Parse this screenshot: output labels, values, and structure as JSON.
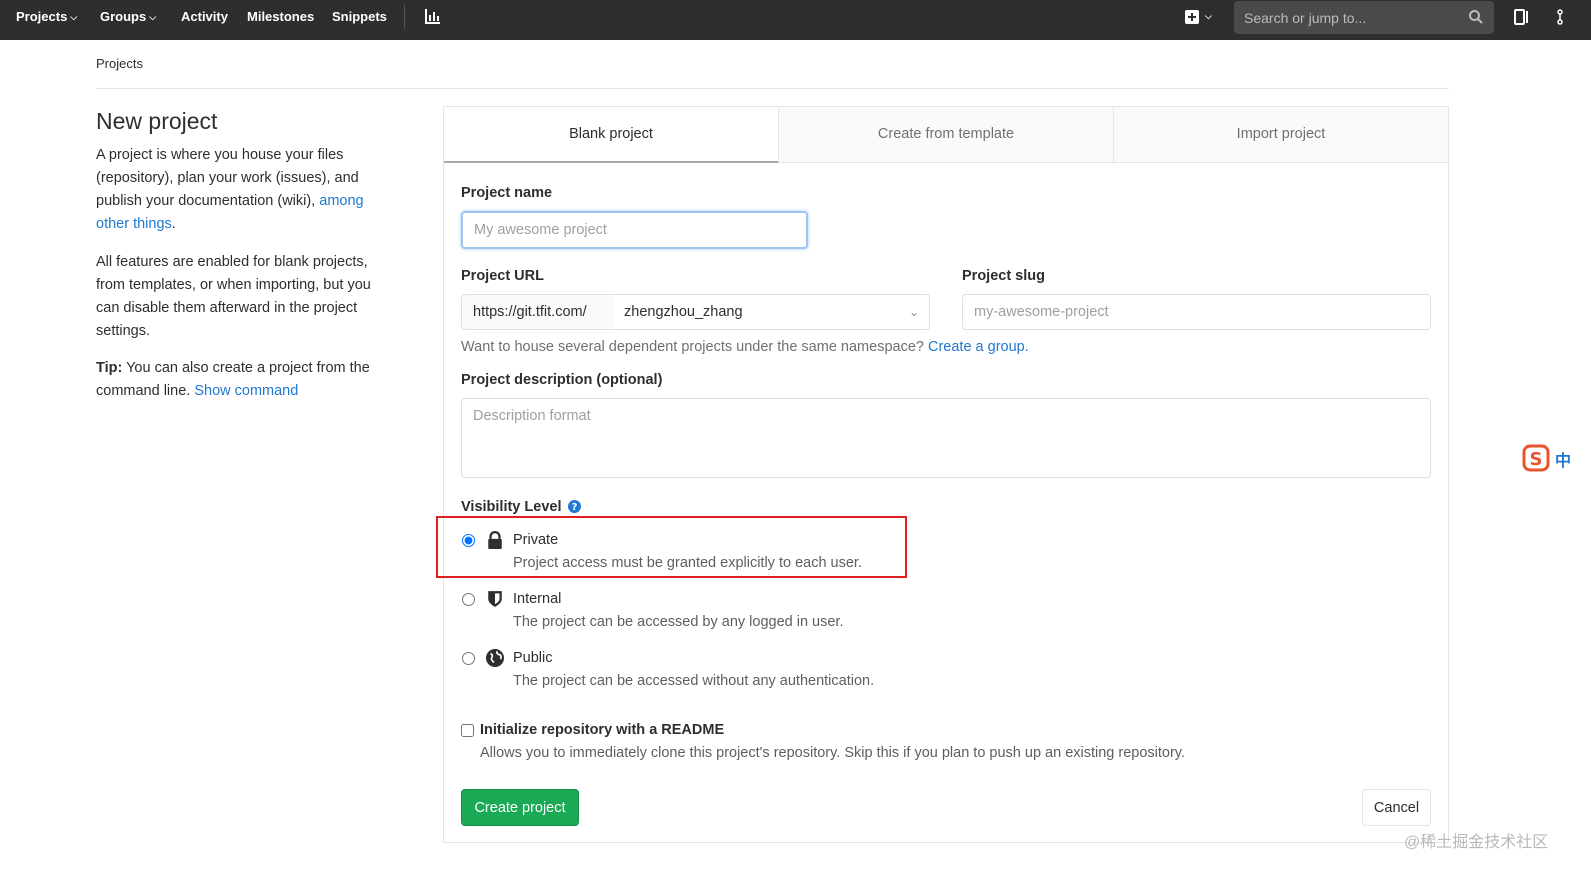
{
  "navbar": {
    "items": [
      {
        "label": "Projects",
        "has_dropdown": true
      },
      {
        "label": "Groups",
        "has_dropdown": true
      },
      {
        "label": "Activity",
        "has_dropdown": false
      },
      {
        "label": "Milestones",
        "has_dropdown": false
      },
      {
        "label": "Snippets",
        "has_dropdown": false
      }
    ],
    "chart_icon": "chart-icon",
    "new_icon": "plus-square-icon",
    "search": {
      "placeholder": "Search or jump to...",
      "icon": "search-icon"
    },
    "right_icons": [
      "issues-icon",
      "merge-request-icon"
    ]
  },
  "breadcrumb": {
    "label": "Projects"
  },
  "intro": {
    "title": "New project",
    "para1_text": "A project is where you house your files (repository), plan your work (issues), and publish your documentation (wiki),",
    "para1_link": "among other things",
    "para1_end": ".",
    "para2": "All features are enabled for blank projects, from templates, or when importing, but you can disable them afterward in the project settings.",
    "tip_label": "Tip:",
    "tip_text": "You can also create a project from the command line.",
    "tip_link": "Show command"
  },
  "tabs": [
    {
      "label": "Blank project",
      "active": true
    },
    {
      "label": "Create from template",
      "active": false
    },
    {
      "label": "Import project",
      "active": false
    }
  ],
  "form": {
    "project_name_label": "Project name",
    "project_name_placeholder": "My awesome project",
    "project_url_label": "Project URL",
    "url_prefix": "https://git.tfit.com/",
    "namespace": "zhengzhou_zhang",
    "project_slug_label": "Project slug",
    "project_slug_placeholder": "my-awesome-project",
    "namespace_help": "Want to house several dependent projects under the same namespace?",
    "namespace_help_link": "Create a group.",
    "description_label": "Project description (optional)",
    "description_placeholder": "Description format",
    "visibility_label": "Visibility Level",
    "visibility_options": [
      {
        "title": "Private",
        "desc": "Project access must be granted explicitly to each user.",
        "icon": "lock-icon",
        "checked": true
      },
      {
        "title": "Internal",
        "desc": "The project can be accessed by any logged in user.",
        "icon": "shield-icon",
        "checked": false
      },
      {
        "title": "Public",
        "desc": "The project can be accessed without any authentication.",
        "icon": "globe-icon",
        "checked": false
      }
    ],
    "readme_title": "Initialize repository with a README",
    "readme_desc": "Allows you to immediately clone this project's repository. Skip this if you plan to push up an existing repository.",
    "create_button": "Create project",
    "cancel_button": "Cancel"
  },
  "ime_badge": "中",
  "watermark": "@稀土掘金技术社区",
  "colors": {
    "navbar": "#2e2e2e",
    "link": "#1f78d1",
    "create_button": "#1aaa55",
    "highlight": "#e02020"
  }
}
